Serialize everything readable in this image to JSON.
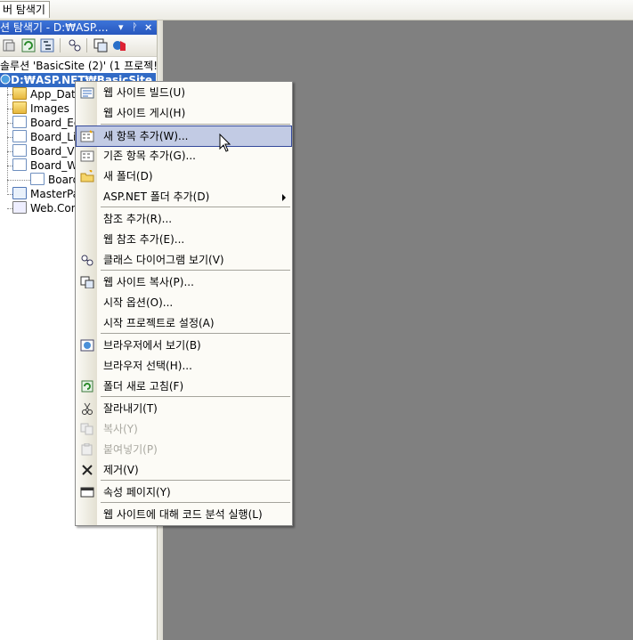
{
  "tab": {
    "label": "버 탐색기"
  },
  "solution_explorer": {
    "title": "션 탐색기 - D:₩ASP....",
    "controls": {
      "dropdown": "▾",
      "pin": "ᚹ",
      "close": "×"
    },
    "solution_line": "솔루션 'BasicSite (2)' (1 프로젝!",
    "project_line": "D:₩ASP.NET₩BasicSite",
    "items": [
      {
        "label": "App_Data",
        "icon": "folder-icon"
      },
      {
        "label": "Images",
        "icon": "folder-icon"
      },
      {
        "label": "Board_Ed",
        "icon": "aspx-page-icon"
      },
      {
        "label": "Board_Li",
        "icon": "aspx-page-icon"
      },
      {
        "label": "Board_Vi",
        "icon": "aspx-page-icon"
      },
      {
        "label": "Board_W",
        "icon": "aspx-page-icon"
      },
      {
        "label": "Board",
        "icon": "code-file-icon"
      },
      {
        "label": "MasterPa",
        "icon": "master-page-icon"
      },
      {
        "label": "Web.Con",
        "icon": "config-file-icon"
      }
    ]
  },
  "context_menu": {
    "items": [
      {
        "label": "웹 사이트 빌드(U)",
        "icon": "build-icon"
      },
      {
        "label": "웹 사이트 게시(H)"
      },
      {
        "label": "새 항목 추가(W)...",
        "icon": "add-new-item-icon",
        "selected": true
      },
      {
        "label": "기존 항목 추가(G)...",
        "icon": "add-existing-item-icon"
      },
      {
        "label": "새 폴더(D)",
        "icon": "new-folder-icon"
      },
      {
        "label": "ASP.NET 폴더 추가(D)",
        "submenu": true
      },
      {
        "label": "참조 추가(R)..."
      },
      {
        "label": "웹 참조 추가(E)..."
      },
      {
        "label": "클래스 다이어그램 보기(V)",
        "icon": "class-diagram-icon"
      },
      {
        "label": "웹 사이트 복사(P)...",
        "icon": "copy-website-icon"
      },
      {
        "label": "시작 옵션(O)..."
      },
      {
        "label": "시작 프로젝트로 설정(A)"
      },
      {
        "label": "브라우저에서 보기(B)",
        "icon": "view-in-browser-icon"
      },
      {
        "label": "브라우저 선택(H)..."
      },
      {
        "label": "폴더 새로 고침(F)",
        "icon": "refresh-folder-icon"
      },
      {
        "label": "잘라내기(T)",
        "icon": "cut-icon"
      },
      {
        "label": "복사(Y)",
        "icon": "copy-icon",
        "disabled": true
      },
      {
        "label": "붙여넣기(P)",
        "icon": "paste-icon",
        "disabled": true
      },
      {
        "label": "제거(V)",
        "icon": "remove-icon"
      },
      {
        "label": "속성 페이지(Y)",
        "icon": "property-pages-icon"
      },
      {
        "label": "웹 사이트에 대해 코드 분석 실행(L)"
      }
    ]
  }
}
